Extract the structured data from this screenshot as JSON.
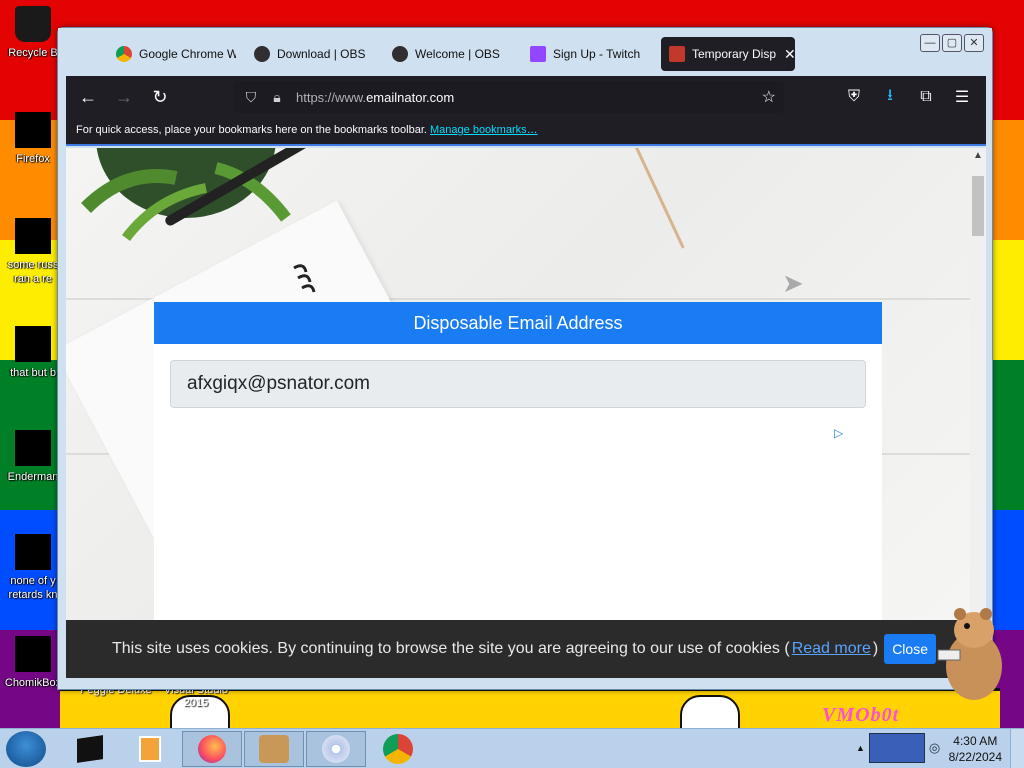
{
  "desktop": {
    "icons": [
      {
        "label": "Recycle B"
      },
      {
        "label": "Firefox"
      },
      {
        "label": "some russ"
      },
      {
        "label": "that but b"
      },
      {
        "label": "Enderman"
      },
      {
        "label": "none of y"
      },
      {
        "label": "ChomikBox"
      }
    ],
    "icon_sublabels": {
      "russ_line2": "ran a re",
      "none_line2": "retards kn",
      "peggle": "Peggle Deluxe",
      "visual_studio": "Visual Studio 2015"
    },
    "vm_logo": "VMOb0t"
  },
  "browser": {
    "tabs": [
      {
        "label": "Google Chrome W",
        "icon_color": "#db4437"
      },
      {
        "label": "Download | OBS",
        "icon_color": "#302e31"
      },
      {
        "label": "Welcome | OBS",
        "icon_color": "#302e31"
      },
      {
        "label": "Sign Up - Twitch",
        "icon_color": "#9146ff"
      },
      {
        "label": "Temporary Disp",
        "icon_color": "#c0392b"
      }
    ],
    "tab_close_glyph": "✕",
    "window_buttons": [
      "—",
      "▢",
      "✕"
    ],
    "url": {
      "prefix": "https://www.",
      "domain": "emailnator.com"
    },
    "bookmarks_bar": {
      "message": "For quick access, place your bookmarks here on the bookmarks toolbar.",
      "link": "Manage bookmarks…"
    },
    "toolbar_icons": [
      "back-icon",
      "forward-icon",
      "reload-icon",
      "shield-icon",
      "lock-icon",
      "star-icon",
      "pocket-icon",
      "download-icon",
      "extensions-icon",
      "menu-icon"
    ]
  },
  "page": {
    "card_title": "Disposable Email Address",
    "email_value": "afxgiqx@psnator.com",
    "cookie": {
      "message": "This site uses cookies. By continuing to browse the site you are agreeing to our use of cookies (",
      "read_more": "Read more",
      "close_paren": ")",
      "close_label": "Close"
    }
  },
  "taskbar": {
    "time": "4:30 AM",
    "date": "8/22/2024",
    "colors": {
      "bar": "#b9d1ea"
    }
  }
}
